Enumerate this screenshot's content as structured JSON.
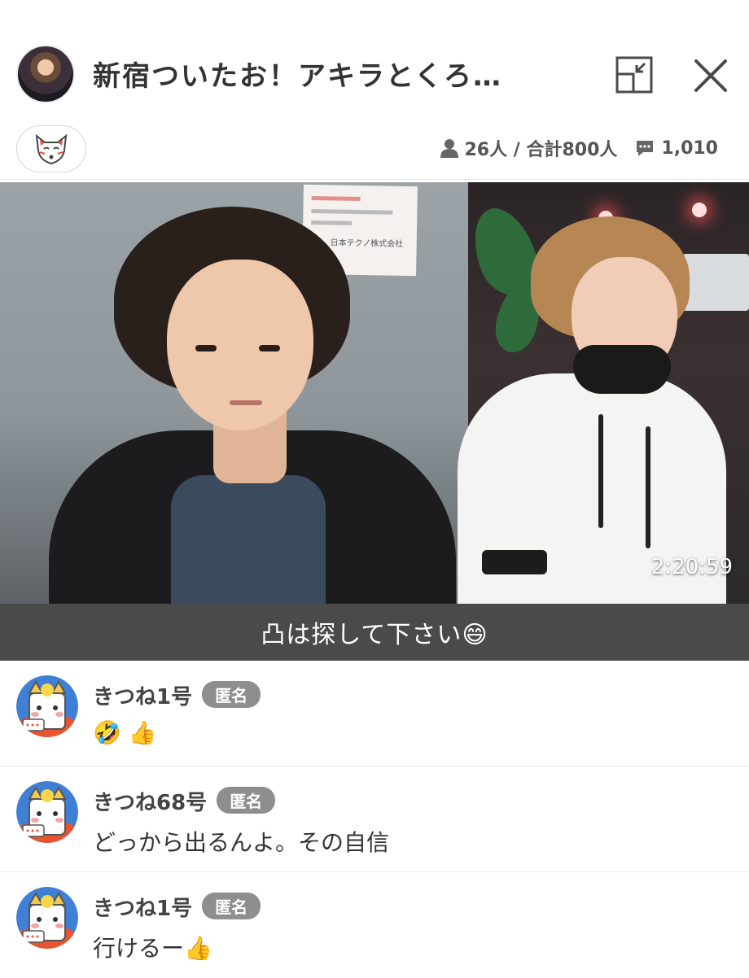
{
  "header": {
    "title": "新宿ついたお！アキラとくろ…",
    "viewers": "26人 / 合計800人",
    "comments_count": "1,010"
  },
  "video": {
    "timestamp": "2:20:59",
    "paper_text": "日本テクノ株式会社"
  },
  "caption": "凸は探して下さい😄",
  "comments": [
    {
      "name": "きつね1号",
      "badge": "匿名",
      "text": "🤣 👍"
    },
    {
      "name": "きつね68号",
      "badge": "匿名",
      "text": "どっから出るんよ。その自信"
    },
    {
      "name": "きつね1号",
      "badge": "匿名",
      "text": "行けるー👍"
    }
  ],
  "icons": {
    "minimize": "minimize-icon",
    "close": "close-icon",
    "fox": "fox-mask-icon",
    "person": "person-icon",
    "comment": "comment-icon"
  },
  "colors": {
    "caption_bg": "#4a4a4a",
    "badge_bg": "#8e8e8e"
  }
}
